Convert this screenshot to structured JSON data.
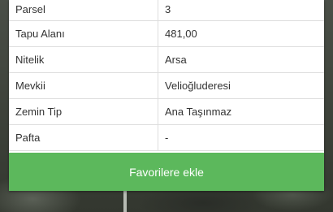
{
  "parcel_info": {
    "rows": [
      {
        "label": "Parsel",
        "value": "3"
      },
      {
        "label": "Tapu Alanı",
        "value": "481,00"
      },
      {
        "label": "Nitelik",
        "value": "Arsa"
      },
      {
        "label": "Mevkii",
        "value": "Velioğluderesi"
      },
      {
        "label": "Zemin Tip",
        "value": "Ana Taşınmaz"
      },
      {
        "label": "Pafta",
        "value": "-"
      }
    ]
  },
  "actions": {
    "favorite_label": "Favorilere ekle"
  },
  "colors": {
    "button_green": "#5cb85c",
    "panel_bg": "#ffffff",
    "border": "#dddddd"
  }
}
